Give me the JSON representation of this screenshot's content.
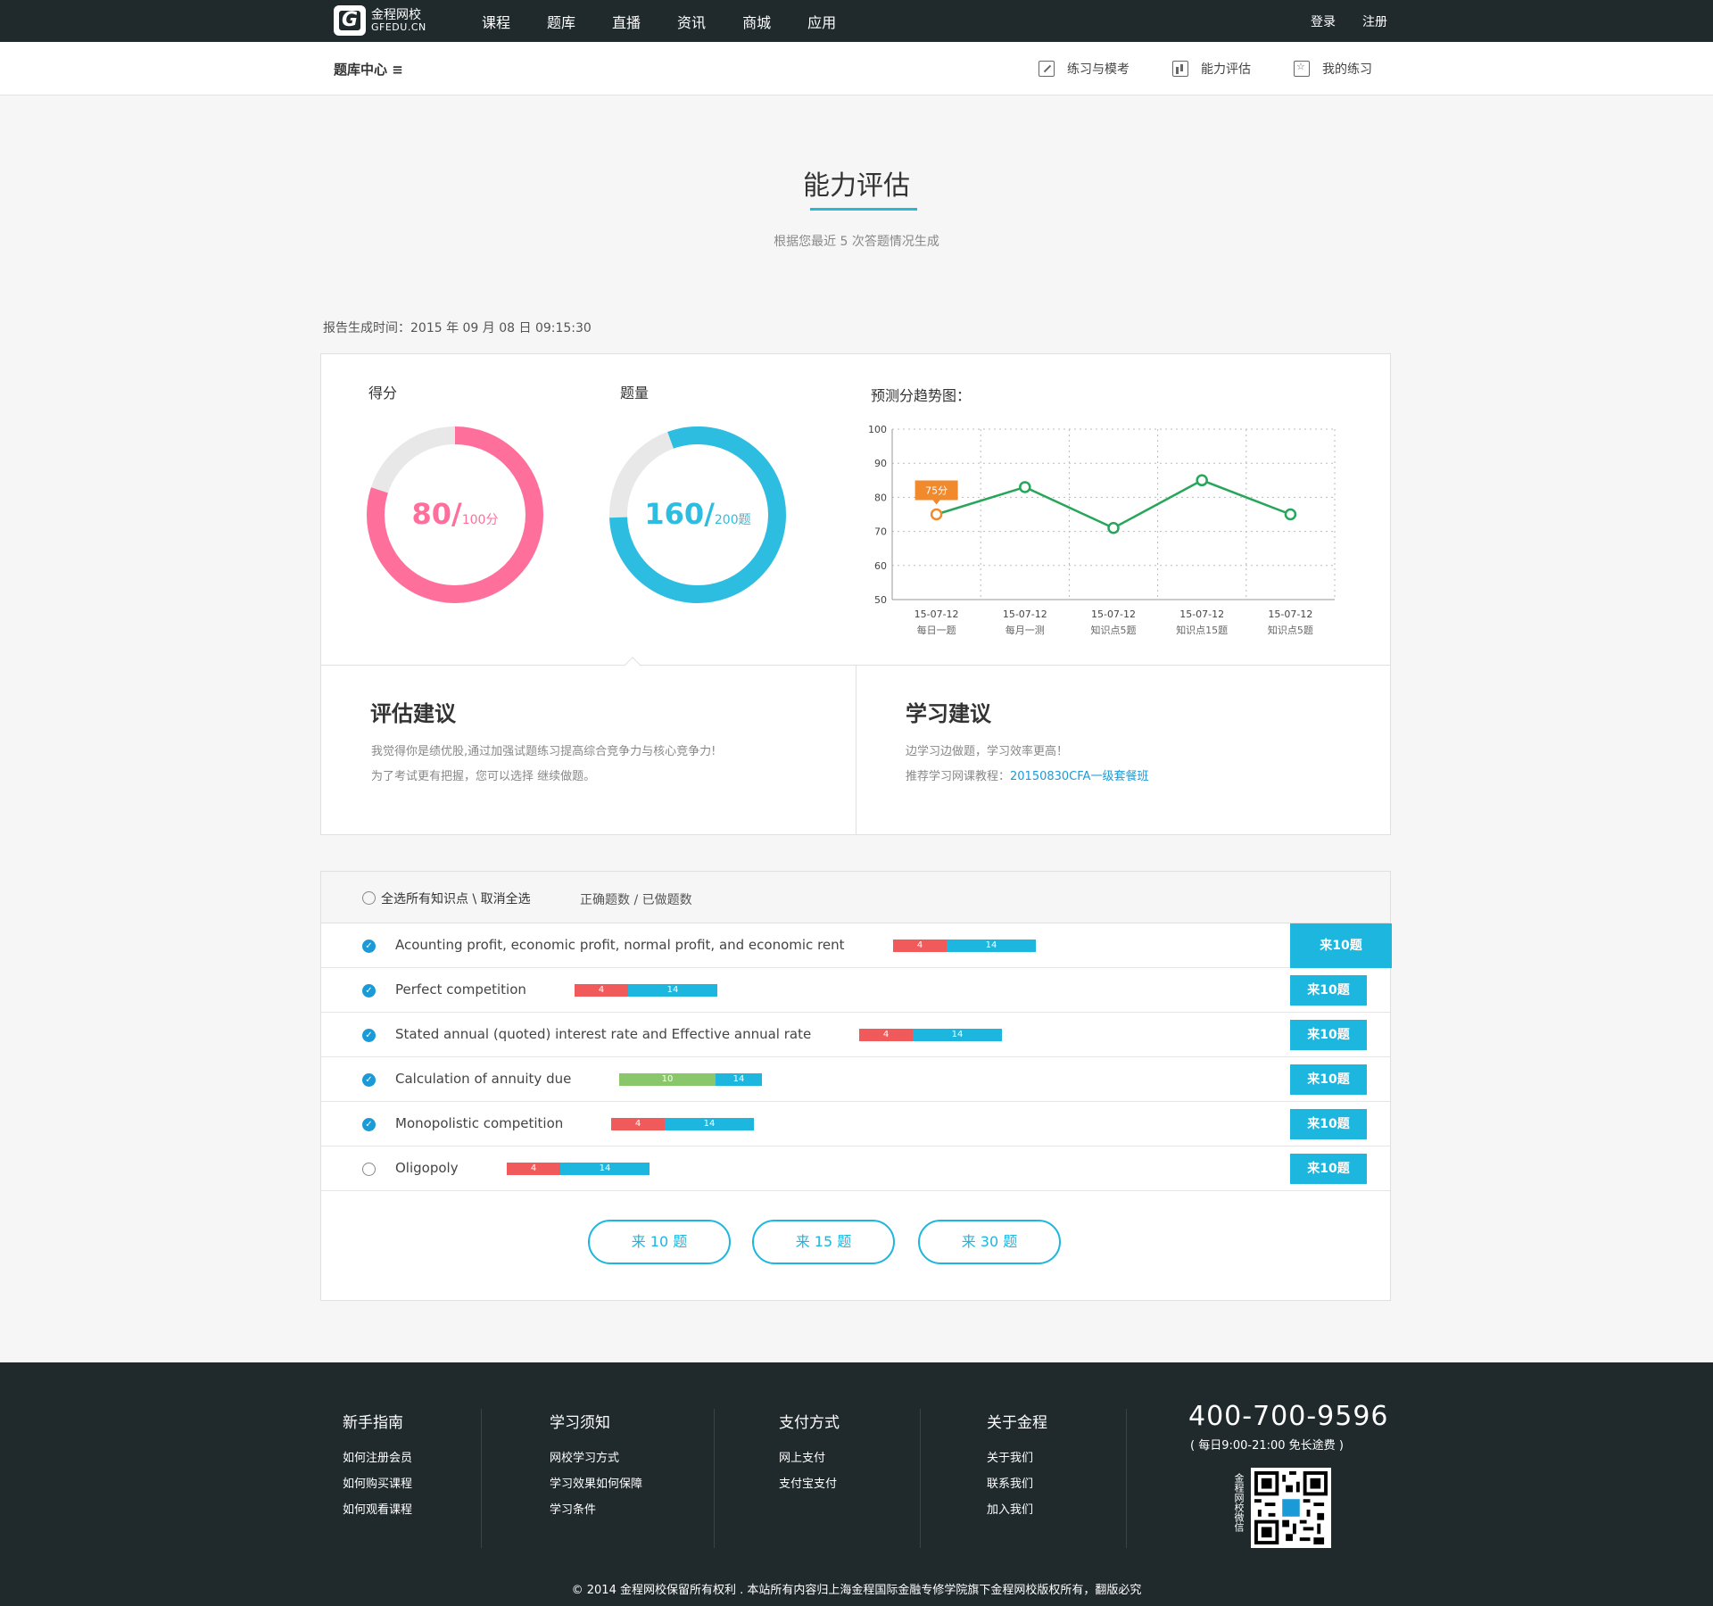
{
  "topbar": {
    "logo_cn": "金程网校",
    "logo_en": "GFEDU.CN",
    "nav": [
      "课程",
      "题库",
      "直播",
      "资讯",
      "商城",
      "应用"
    ],
    "login": "登录",
    "register": "注册"
  },
  "subbar": {
    "title": "题库中心 ≡",
    "items": [
      "练习与模考",
      "能力评估",
      "我的练习"
    ]
  },
  "page": {
    "title": "能力评估",
    "subtitle": "根据您最近 5 次答题情况生成",
    "report_time": "报告生成时间：2015 年 09 月 08 日 09:15:30"
  },
  "score": {
    "label": "得分",
    "value": "80/",
    "total": "100分",
    "fraction": 0.8,
    "color": "#ff6f9c"
  },
  "questions": {
    "label": "题量",
    "value": "160/",
    "total": "200题",
    "fraction": 0.8,
    "color": "#2dbde1"
  },
  "trend": {
    "title": "预测分趋势图：",
    "highlight_label": "75分"
  },
  "chart_data": {
    "type": "line",
    "title": "预测分趋势图：",
    "categories": [
      "15-07-12\n每日一题",
      "15-07-12\n每月一测",
      "15-07-12\n知识点5题",
      "15-07-12\n知识点15题",
      "15-07-12\n知识点5题"
    ],
    "x_dates": [
      "15-07-12",
      "15-07-12",
      "15-07-12",
      "15-07-12",
      "15-07-12"
    ],
    "x_sub": [
      "每日一题",
      "每月一测",
      "知识点5题",
      "知识点15题",
      "知识点5题"
    ],
    "values": [
      75,
      83,
      71,
      85,
      75
    ],
    "ylim": [
      50,
      100
    ],
    "yticks": [
      100,
      90,
      80,
      70,
      60,
      50
    ],
    "grid": true,
    "line_color": "#27a65a"
  },
  "assessment": {
    "title": "评估建议",
    "line1": "我觉得你是绩优股,通过加强试题练习提高综合竞争力与核心竞争力!",
    "line2": "为了考试更有把握，您可以选择 继续做题。"
  },
  "study": {
    "title": "学习建议",
    "line1": "边学习边做题，学习效率更高！",
    "line2_prefix": "推荐学习网课教程：",
    "line2_link": "20150830CFA一级套餐班"
  },
  "knowledge": {
    "select_all": "全选所有知识点 \\ 取消全选",
    "columns": "正确题数 / 已做题数",
    "rows": [
      {
        "name": "Acounting profit, economic profit, normal profit, and economic rent",
        "correct": 4,
        "done": 14,
        "checked": true,
        "button": "来10题"
      },
      {
        "name": "Perfect competition",
        "correct": 4,
        "done": 14,
        "checked": true,
        "button": "来10题"
      },
      {
        "name": "Stated annual (quoted) interest rate and Effective annual rate",
        "correct": 4,
        "done": 14,
        "checked": true,
        "button": "来10题"
      },
      {
        "name": "Calculation of annuity due",
        "correct": 10,
        "done": 14,
        "checked": true,
        "button": "来10题"
      },
      {
        "name": "Monopolistic competition",
        "correct": 4,
        "done": 14,
        "checked": true,
        "button": "来10题"
      },
      {
        "name": "Oligopoly",
        "correct": 4,
        "done": 14,
        "checked": false,
        "button": "来10题"
      }
    ],
    "pills": [
      "来 10 题",
      "来 15 题",
      "来 30 题"
    ]
  },
  "footer": {
    "cols": [
      {
        "title": "新手指南",
        "links": [
          "如何注册会员",
          "如何购买课程",
          "如何观看课程"
        ]
      },
      {
        "title": "学习须知",
        "links": [
          "网校学习方式",
          "学习效果如何保障",
          "学习条件"
        ]
      },
      {
        "title": "支付方式",
        "links": [
          "网上支付",
          "支付宝支付"
        ]
      },
      {
        "title": "关于金程",
        "links": [
          "关于我们",
          "联系我们",
          "加入我们"
        ]
      }
    ],
    "phone": "400-700-9596",
    "phone_sub": "( 每日9:00-21:00   免长途费 )",
    "qr_label": "金程网校微信",
    "copyright": "© 2014 金程网校保留所有权利 . 本站所有内容归上海金程国际金融专修学院旗下金程网校版权所有，翻版必究"
  }
}
